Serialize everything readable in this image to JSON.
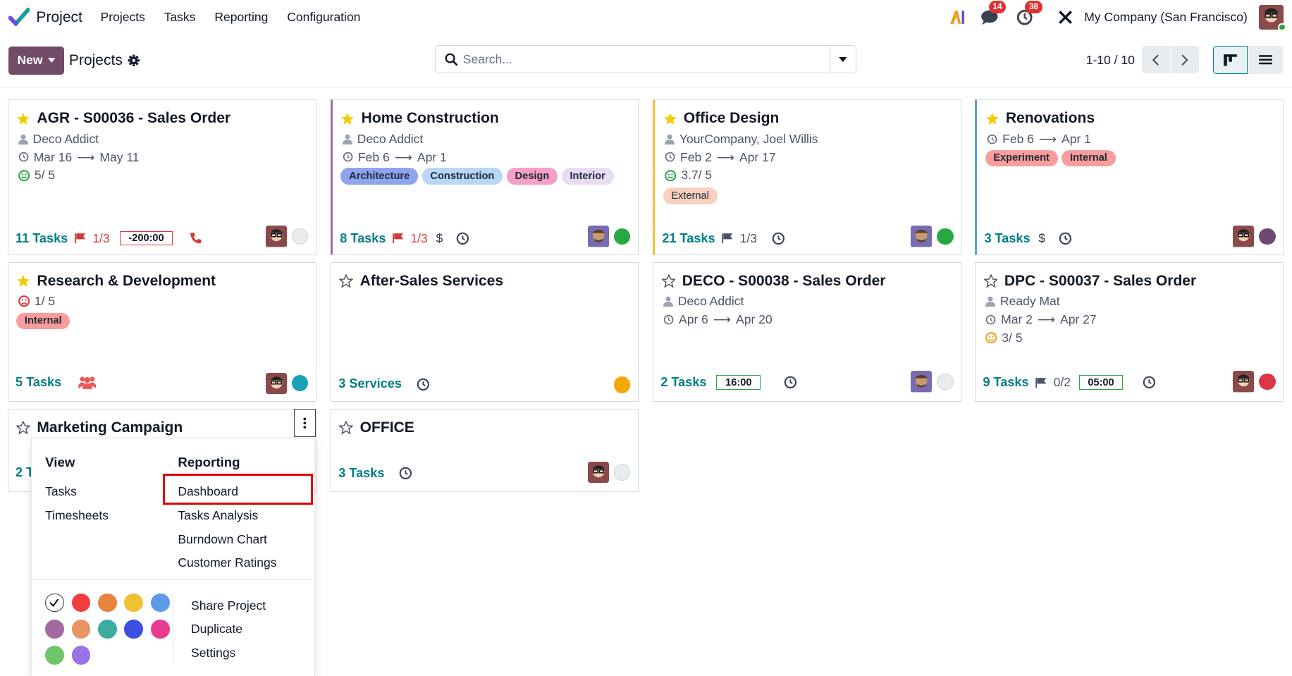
{
  "topnav": {
    "app_name": "Project",
    "menu": [
      "Projects",
      "Tasks",
      "Reporting",
      "Configuration"
    ],
    "messages_count": "14",
    "activities_count": "38",
    "company": "My Company (San Francisco)"
  },
  "control": {
    "new_label": "New",
    "breadcrumb": "Projects",
    "search_placeholder": "Search...",
    "pager": "1-10 / 10"
  },
  "cards": [
    {
      "title": "AGR - S00036 - Sales Order",
      "customer": "Deco Addict",
      "date_start": "Mar 16",
      "date_end": "May 11",
      "rating": "5/ 5",
      "tasks": "11 Tasks",
      "milestones": "1/3",
      "time": "-200:00"
    },
    {
      "title": "Home Construction",
      "customer": "Deco Addict",
      "date_start": "Feb 6",
      "date_end": "Apr 1",
      "tags": [
        "Architecture",
        "Construction",
        "Design",
        "Interior"
      ],
      "tasks": "8 Tasks",
      "milestones": "1/3"
    },
    {
      "title": "Office Design",
      "customer": "YourCompany, Joel Willis",
      "date_start": "Feb 2",
      "date_end": "Apr 17",
      "rating": "3.7/ 5",
      "tags": [
        "External"
      ],
      "tasks": "21 Tasks",
      "milestones": "1/3"
    },
    {
      "title": "Renovations",
      "date_start": "Feb 6",
      "date_end": "Apr 1",
      "tags": [
        "Experiment",
        "Internal"
      ],
      "tasks": "3 Tasks"
    },
    {
      "title": "Research & Development",
      "rating": "1/ 5",
      "tags": [
        "Internal"
      ],
      "tasks": "5 Tasks"
    },
    {
      "title": "After-Sales Services",
      "tasks": "3 Services"
    },
    {
      "title": "DECO - S00038 - Sales Order",
      "customer": "Deco Addict",
      "date_start": "Apr 6",
      "date_end": "Apr 20",
      "tasks": "2 Tasks",
      "time": "16:00"
    },
    {
      "title": "DPC - S00037 - Sales Order",
      "customer": "Ready Mat",
      "date_start": "Mar 2",
      "date_end": "Apr 27",
      "rating": "3/ 5",
      "tasks": "9 Tasks",
      "milestones": "0/2",
      "time": "05:00"
    },
    {
      "title": "Marketing Campaign",
      "tasks": "2 T"
    },
    {
      "title": "OFFICE",
      "tasks": "3 Tasks"
    }
  ],
  "dropdown": {
    "view_header": "View",
    "view_items": [
      "Tasks",
      "Timesheets"
    ],
    "reporting_header": "Reporting",
    "reporting_items": [
      "Dashboard",
      "Tasks Analysis",
      "Burndown Chart",
      "Customer Ratings"
    ],
    "actions": [
      "Share Project",
      "Duplicate",
      "Settings"
    ],
    "colors": [
      "#ffffff",
      "#f03e3e",
      "#e8853d",
      "#f0c132",
      "#5b9bea",
      "#a36aa1",
      "#e89566",
      "#3eaba0",
      "#3b4fe0",
      "#ea3b8e",
      "#6ec56e",
      "#9a73e6"
    ]
  }
}
